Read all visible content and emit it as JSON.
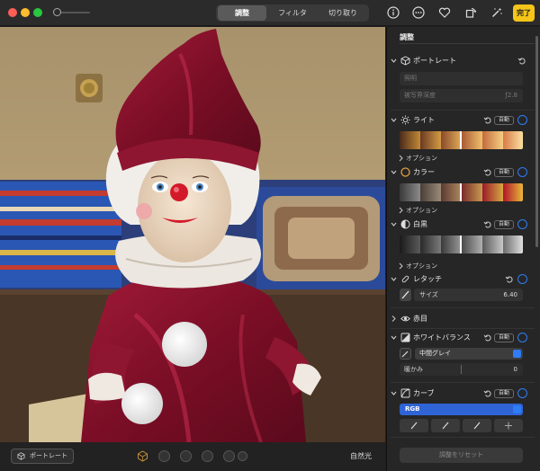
{
  "toolbar": {
    "tabs": [
      "調整",
      "フィルタ",
      "切り取り"
    ],
    "active_tab": "調整",
    "done_label": "完了",
    "icons": [
      "info-icon",
      "more-icon",
      "heart-icon",
      "rotate-icon",
      "magic-wand-icon"
    ],
    "accent": "#f5c518"
  },
  "bottombar": {
    "portrait_label": "ポートレート",
    "lighting_label": "自然光"
  },
  "sidebar": {
    "title": "調整",
    "auto_label": "自動",
    "option_label": "オプション",
    "portrait": {
      "label": "ポートレート",
      "lighting_field": "照明",
      "depth_field": "被写界深度",
      "depth_value": "ƒ2.8"
    },
    "light": {
      "label": "ライト"
    },
    "color": {
      "label": "カラー"
    },
    "bw": {
      "label": "白黒"
    },
    "retouch": {
      "label": "レタッチ",
      "size_label": "サイズ",
      "size_value": "6.40"
    },
    "redeye": {
      "label": "赤目"
    },
    "white_balance": {
      "label": "ホワイトバランス",
      "mode": "中間グレイ",
      "warmth_label": "暖かみ",
      "warmth_value": "0"
    },
    "curves": {
      "label": "カーブ",
      "channel": "RGB"
    },
    "reset_label": "調整をリセット",
    "toggle_color": "#2f7cf6"
  }
}
